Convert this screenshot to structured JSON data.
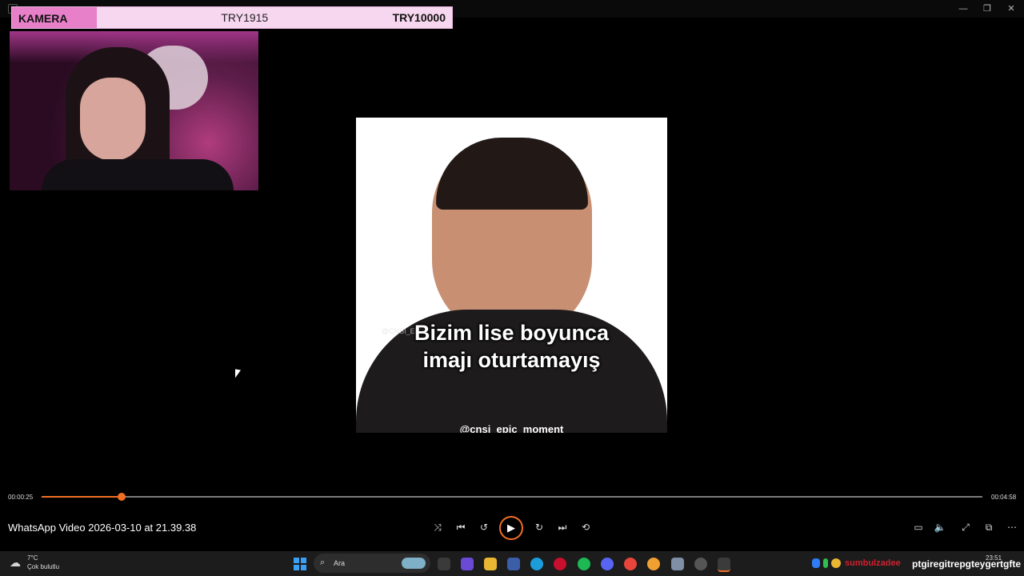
{
  "overlay": {
    "label": "KAMERA",
    "middle": "TRY1915",
    "right": "TRY10000"
  },
  "window": {
    "minimize_glyph": "—",
    "maximize_glyph": "❐",
    "close_glyph": "✕"
  },
  "video": {
    "caption_line1": "Bizim lise boyunca",
    "caption_line2": "imajı oturtamayış",
    "handle": "@cnsi_epic_moment",
    "small_watermark": "@CNSI_EPIC"
  },
  "player": {
    "title": "WhatsApp Video 2026-03-10 at 21.39.38",
    "current_time": "00:00:25",
    "duration": "00:04:58",
    "progress_fraction": 0.085,
    "accent_color": "#f16f24",
    "controls": {
      "shuffle_icon": "⤨",
      "previous_icon": "⏮",
      "rewind_icon": "↺",
      "play_icon": "▶",
      "forward_icon": "↻",
      "next_icon": "⏭",
      "repeat_icon": "⟲",
      "captions_icon": "▭",
      "volume_icon": "🔈",
      "fullscreen_icon": "⤢",
      "miniplayer_icon": "⧉",
      "more_icon": "⋯"
    }
  },
  "taskbar": {
    "weather_icon": "☁",
    "weather_temp": "7°C",
    "weather_desc": "Çok bulutlu",
    "search_placeholder": "Ara",
    "search_icon": "⌕",
    "tray_user": "sumbulzadee",
    "tray_marquee": "ptgiregitrepgteygertgfte",
    "clock_time": "23:51"
  }
}
